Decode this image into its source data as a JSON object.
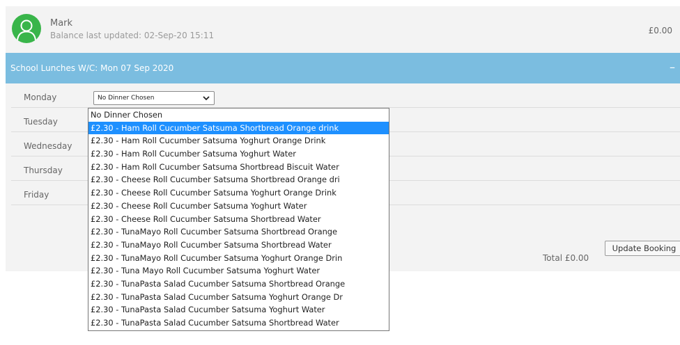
{
  "account": {
    "name": "Mark",
    "balance_updated": "Balance last updated: 02-Sep-20 15:11",
    "balance": "£0.00",
    "avatar_icon": "user-avatar-icon"
  },
  "section": {
    "title": "School Lunches W/C: Mon 07 Sep 2020",
    "collapse_symbol": "–"
  },
  "days": [
    {
      "label": "Monday",
      "selected": "No Dinner Chosen"
    },
    {
      "label": "Tuesday"
    },
    {
      "label": "Wednesday"
    },
    {
      "label": "Thursday"
    },
    {
      "label": "Friday"
    }
  ],
  "footer": {
    "total": "Total £0.00",
    "update_button": "Update Booking"
  },
  "dropdown": {
    "highlighted_index": 1,
    "options": [
      "No Dinner Chosen",
      "£2.30 - Ham Roll Cucumber Satsuma Shortbread Orange drink",
      "£2.30 - Ham Roll Cucumber Satsuma Yoghurt Orange Drink",
      "£2.30 - Ham Roll Cucumber Satsuma Yoghurt Water",
      "£2.30 - Ham Roll Cucumber Satsuma Shortbread Biscuit Water",
      "£2.30 - Cheese Roll Cucumber Satsuma Shortbread Orange dri",
      "£2.30 - Cheese Roll Cucumber Satsuma Yoghurt Orange Drink",
      "£2.30 - Cheese Roll Cucumber Satsuma Yoghurt Water",
      "£2.30 - Cheese Roll Cucumber Satsuma Shortbread Water",
      "£2.30 - TunaMayo Roll Cucumber Satsuma Shortbread Orange",
      "£2.30 - TunaMayo Roll Cucumber Satsuma Shortbread Water",
      "£2.30 - TunaMayo Roll Cucumber Satsuma Yoghurt Orange Drin",
      "£2.30 - Tuna Mayo Roll Cucumber Satsuma Yoghurt Water",
      "£2.30 - TunaPasta Salad Cucumber Satsuma Shortbread Orange",
      "£2.30 - TunaPasta Salad Cucumber Satsuma Yoghurt Orange Dr",
      "£2.30 - TunaPasta Salad Cucumber Satsuma Yoghurt Water",
      "£2.30 - TunaPasta Salad Cucumber Satsuma Shortbread Water"
    ]
  },
  "colors": {
    "section_bar": "#7bbde0",
    "avatar": "#39b54a",
    "highlight": "#1e90ff"
  }
}
